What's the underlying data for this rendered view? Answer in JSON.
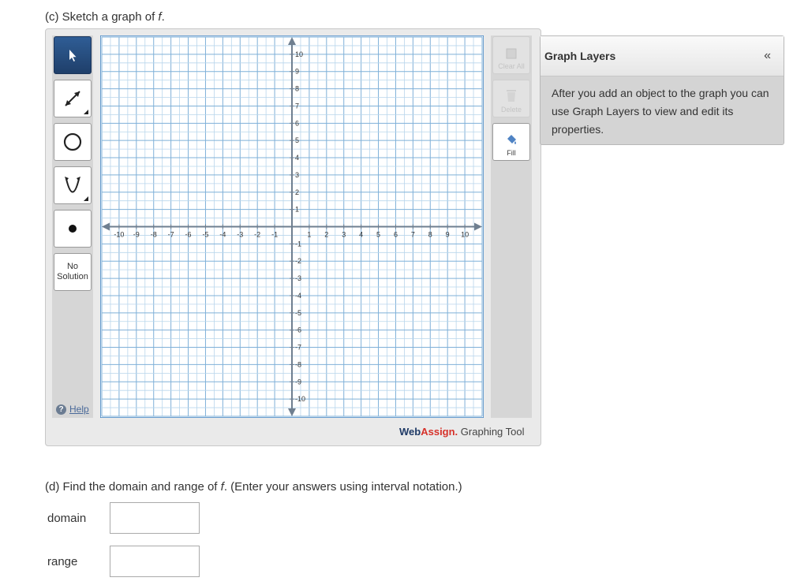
{
  "question_c": {
    "label": "(c) Sketch a graph of ",
    "var": "f",
    "suffix": "."
  },
  "left_tools": {
    "select": "select-tool",
    "line": "line-tool",
    "circle": "circle-tool",
    "parabola": "parabola-tool",
    "point": "point-tool",
    "no_solution_line1": "No",
    "no_solution_line2": "Solution"
  },
  "help_label": "Help",
  "right_tools": {
    "clear_all": "Clear All",
    "delete": "Delete",
    "fill": "Fill"
  },
  "branding": {
    "part1": "Web",
    "part2": "Assign.",
    "part3": " Graphing Tool"
  },
  "graph": {
    "x_ticks": [
      "-10",
      "-9",
      "-8",
      "-7",
      "-6",
      "-5",
      "-4",
      "-3",
      "-2",
      "-1",
      "1",
      "2",
      "3",
      "4",
      "5",
      "6",
      "7",
      "8",
      "9",
      "10"
    ],
    "y_ticks": [
      "10",
      "9",
      "8",
      "7",
      "6",
      "5",
      "4",
      "3",
      "2",
      "1",
      "-1",
      "-2",
      "-3",
      "-4",
      "-5",
      "-6",
      "-7",
      "-8",
      "-9",
      "-10"
    ],
    "xlim": [
      -11,
      11
    ],
    "ylim": [
      -11,
      11
    ],
    "grid": true
  },
  "layers": {
    "title": "Graph Layers",
    "collapse": "«",
    "body": "After you add an object to the graph you can use Graph Layers to view and edit its properties."
  },
  "question_d": {
    "part1": "(d) Find the domain and range of ",
    "var": "f",
    "part2": ". (Enter your answers using interval notation.)"
  },
  "fields": {
    "domain_label": "domain",
    "domain_value": "",
    "range_label": "range",
    "range_value": ""
  }
}
